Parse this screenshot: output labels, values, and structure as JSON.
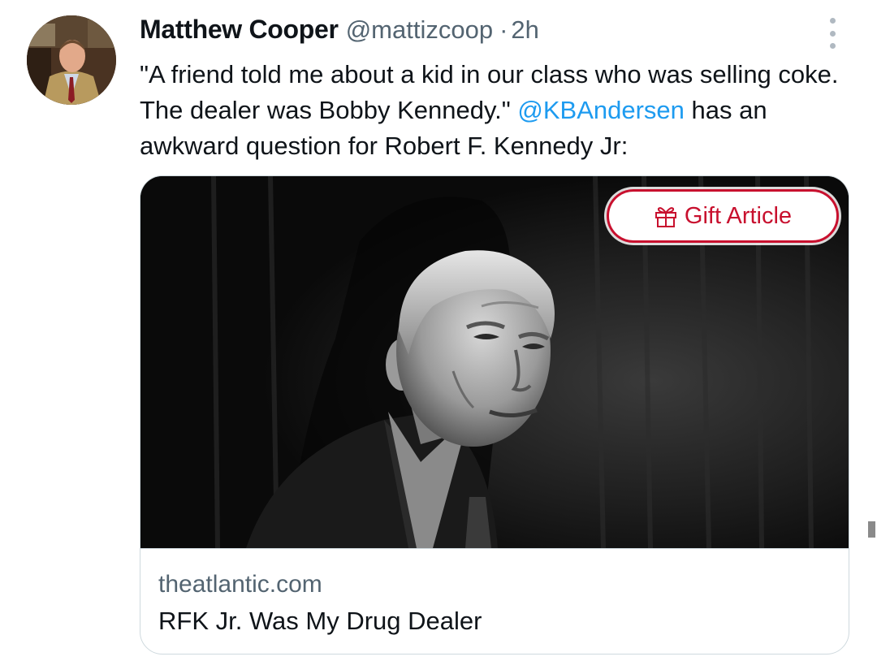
{
  "author": {
    "display_name": "Matthew Cooper",
    "handle": "@mattizcoop",
    "separator": "·",
    "time": "2h"
  },
  "icons": {
    "more": "more-vertical-icon",
    "gift": "gift-icon"
  },
  "tweet": {
    "text_part1": "\"A friend told me about a kid in our class who was selling coke. The dealer was Bobby Kennedy.\" ",
    "mention": "@KBAndersen",
    "text_part2": " has an awkward question for Robert F. Kennedy Jr:"
  },
  "card": {
    "badge_label": "Gift Article",
    "domain": "theatlantic.com",
    "title": "RFK Jr. Was My Drug Dealer"
  },
  "colors": {
    "link": "#1d9bf0",
    "secondary_text": "#536471",
    "badge_red": "#c8102e",
    "border": "#cfd9de"
  }
}
